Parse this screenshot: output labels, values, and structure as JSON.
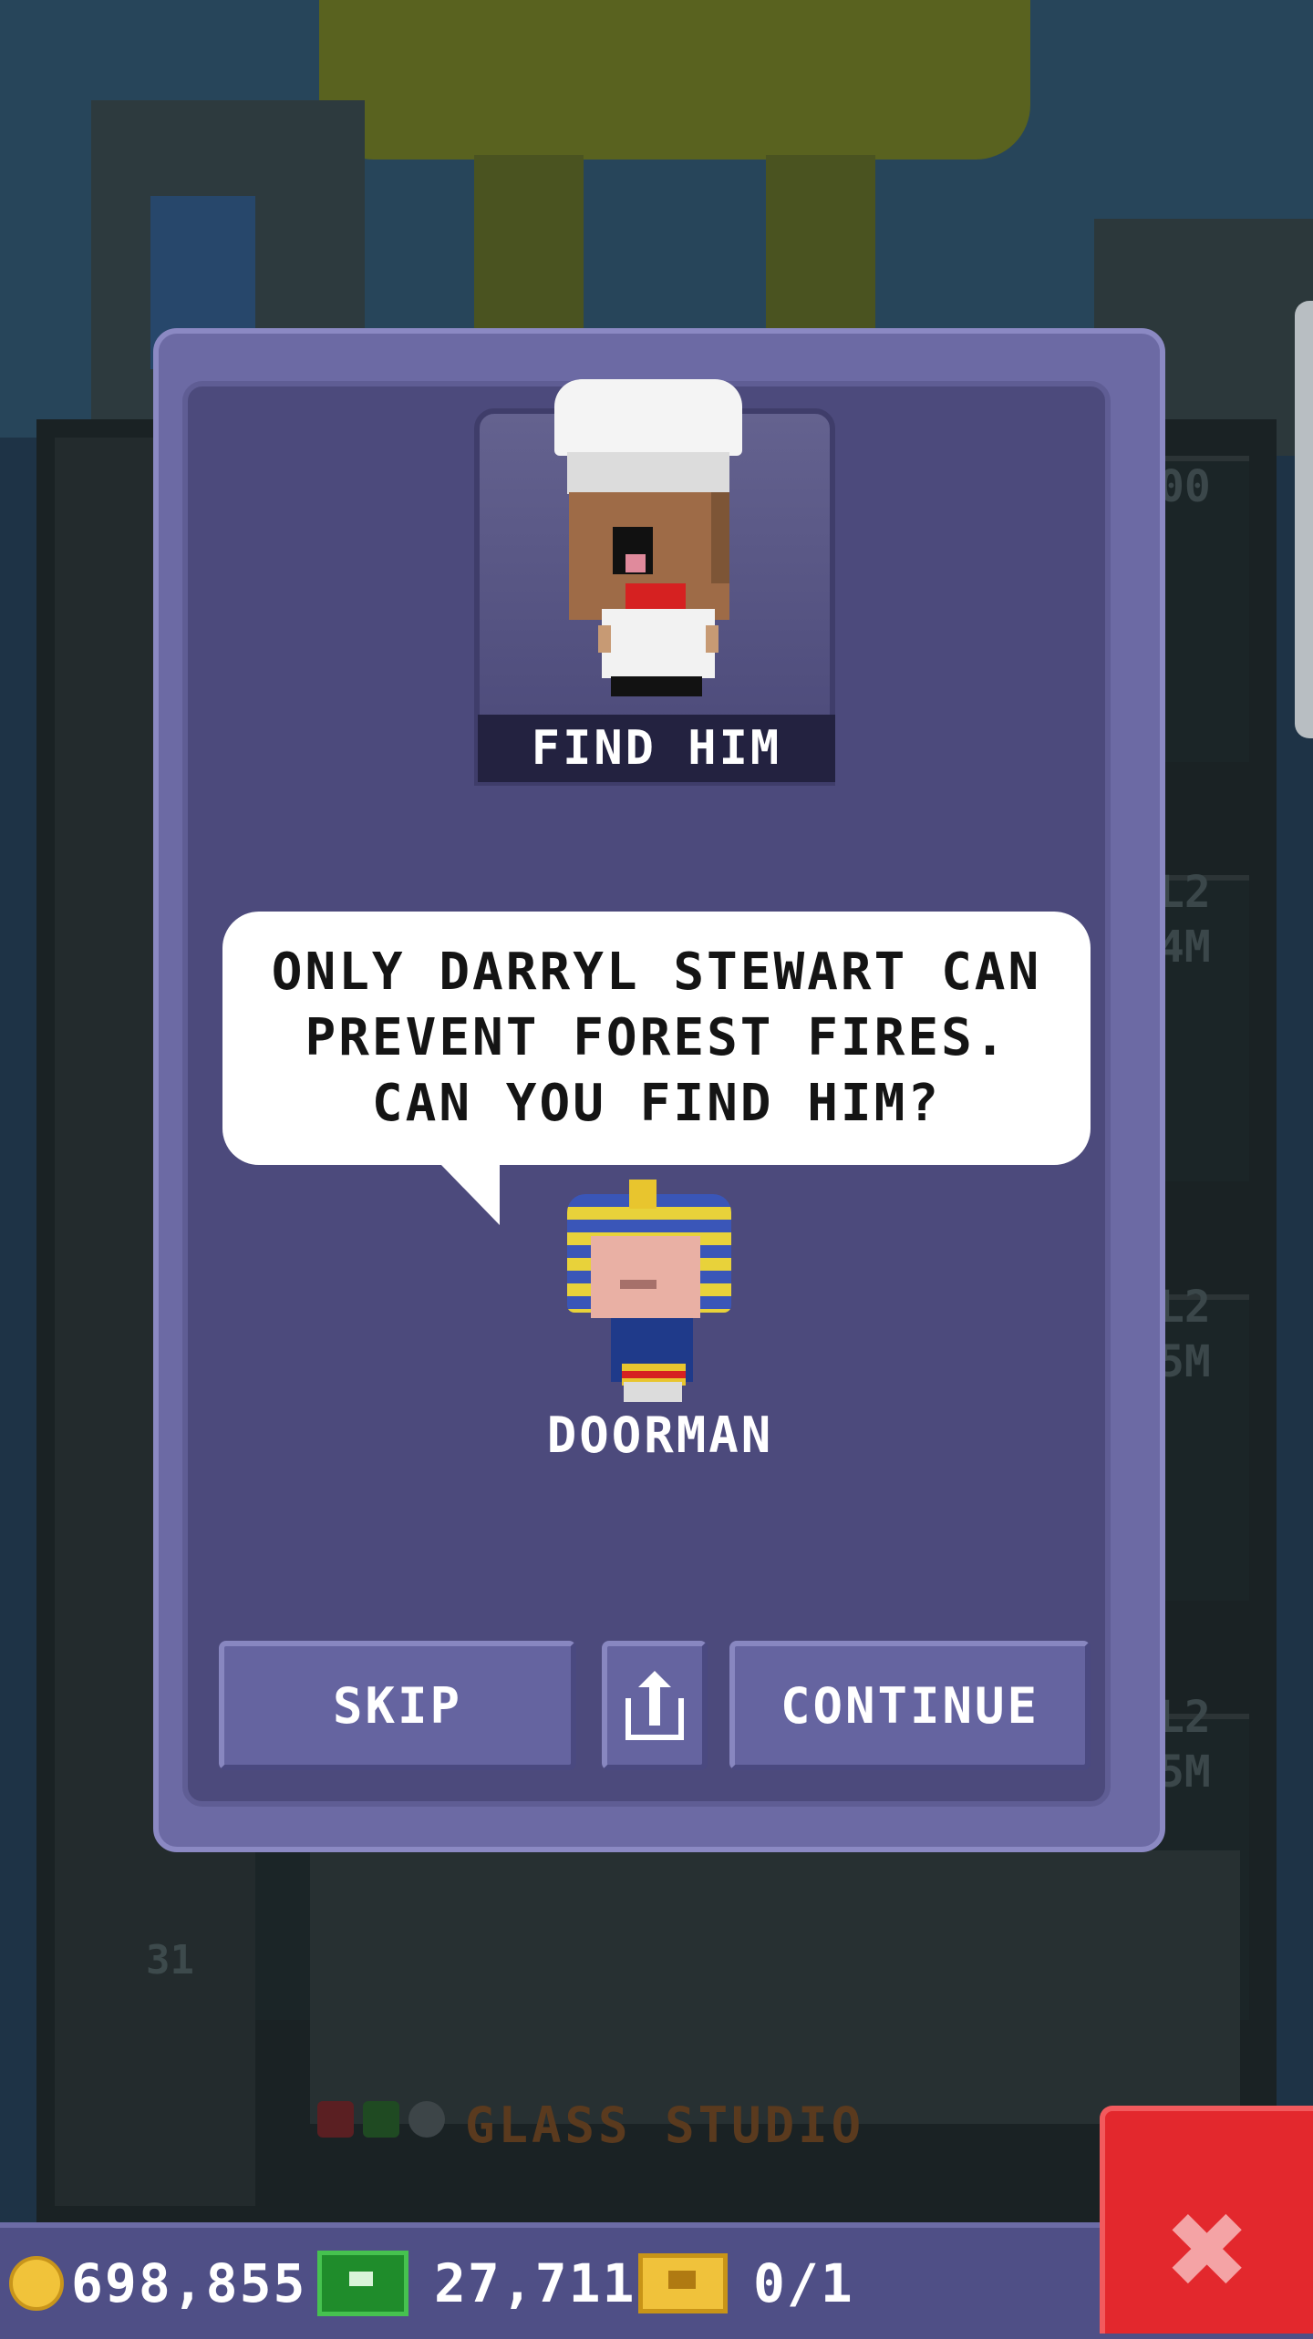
{
  "modal": {
    "portrait_label": "FIND HIM",
    "speech": "ONLY DARRYL STEWART CAN PREVENT FOREST FIRES. CAN YOU FIND HIM?",
    "speaker_name": "DOORMAN",
    "buttons": {
      "skip": "SKIP",
      "continue": "CONTINUE",
      "share_icon": "share-icon"
    }
  },
  "background": {
    "floor_name": "GLASS STUDIO",
    "floor_number": "31",
    "right_labels": [
      "00",
      "L2",
      "4M",
      "L2",
      "5M",
      "L2",
      "5M"
    ]
  },
  "status_bar": {
    "coins": "698,855",
    "bux": "27,711",
    "tickets": "0/1",
    "icons": [
      "coin-icon",
      "bux-icon",
      "ticket-icon"
    ]
  },
  "close_button": {
    "icon": "close-icon",
    "glyph": "✖"
  },
  "colors": {
    "modal_frame": "#6c6aa4",
    "modal_inner": "#4c4a7c",
    "button": "#6564a0",
    "close_button": "#e3282d",
    "status_bar": "#4f4f86"
  }
}
